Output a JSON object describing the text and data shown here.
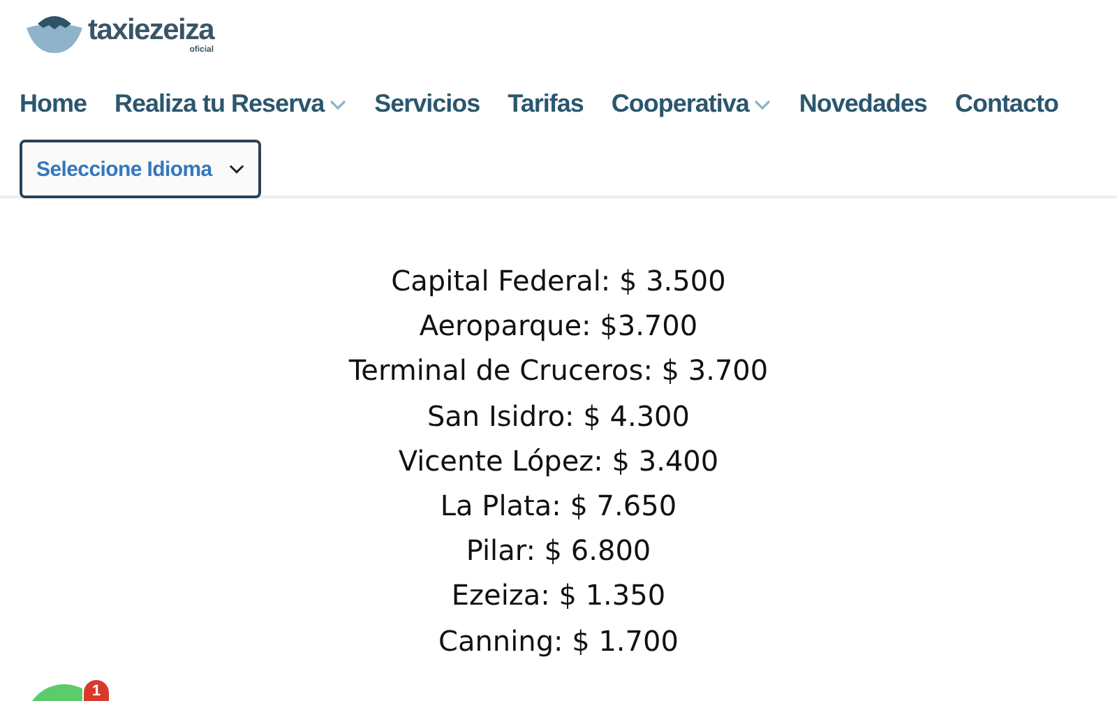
{
  "logo": {
    "name": "taxiezeiza",
    "tagline": "oficial"
  },
  "nav": [
    {
      "label": "Home",
      "has_dropdown": false
    },
    {
      "label": "Realiza tu Reserva",
      "has_dropdown": true
    },
    {
      "label": "Servicios",
      "has_dropdown": false
    },
    {
      "label": "Tarifas",
      "has_dropdown": false
    },
    {
      "label": "Cooperativa",
      "has_dropdown": true
    },
    {
      "label": "Novedades",
      "has_dropdown": false
    },
    {
      "label": "Contacto",
      "has_dropdown": false
    }
  ],
  "language_select": {
    "label": "Seleccione Idioma"
  },
  "prices": [
    "Capital Federal: $ 3.500",
    "Aeroparque: $3.700",
    "Terminal de Cruceros: $ 3.700",
    "San Isidro: $ 4.300",
    "Vicente López: $ 3.400",
    "La Plata: $ 7.650",
    "Pilar: $ 6.800",
    "Ezeiza: $ 1.350",
    "Canning: $ 1.700"
  ],
  "chat_button": {
    "badge": "1"
  }
}
